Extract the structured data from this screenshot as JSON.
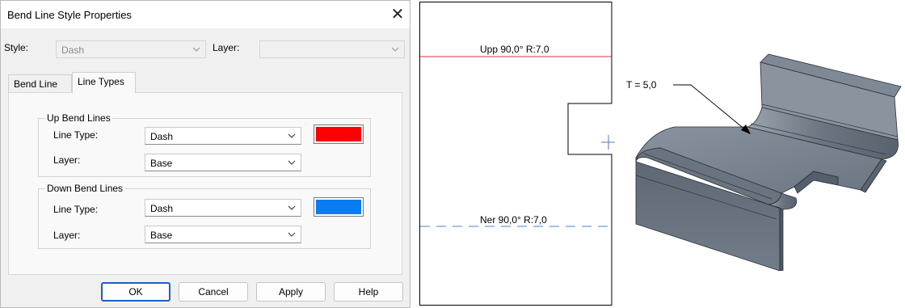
{
  "dialog": {
    "title": "Bend Line Style Properties",
    "close_glyph": "✕",
    "style_label": "Style:",
    "style_value": "Dash",
    "layer_label": "Layer:",
    "layer_value": "",
    "tabs": [
      {
        "label": "Bend Line",
        "active": false
      },
      {
        "label": "Line Types",
        "active": true
      }
    ],
    "up_group": {
      "title": "Up Bend Lines",
      "line_type_label": "Line Type:",
      "line_type_value": "Dash",
      "layer_label": "Layer:",
      "layer_value": "Base",
      "color": "#ff0000"
    },
    "down_group": {
      "title": "Down Bend Lines",
      "line_type_label": "Line Type:",
      "line_type_value": "Dash",
      "layer_label": "Layer:",
      "layer_value": "Base",
      "color": "#0a7cf2"
    },
    "buttons": {
      "ok": "OK",
      "cancel": "Cancel",
      "apply": "Apply",
      "help": "Help"
    }
  },
  "drawing": {
    "up_label": "Upp 90,0° R:7,0",
    "down_label": "Ner 90,0° R:7,0",
    "up_color": "#e03030",
    "down_color": "#3a8ad6",
    "marker_color": "#5c6fb8"
  },
  "model": {
    "thickness_label": "T = 5,0",
    "part_color": "#6f7a86"
  }
}
